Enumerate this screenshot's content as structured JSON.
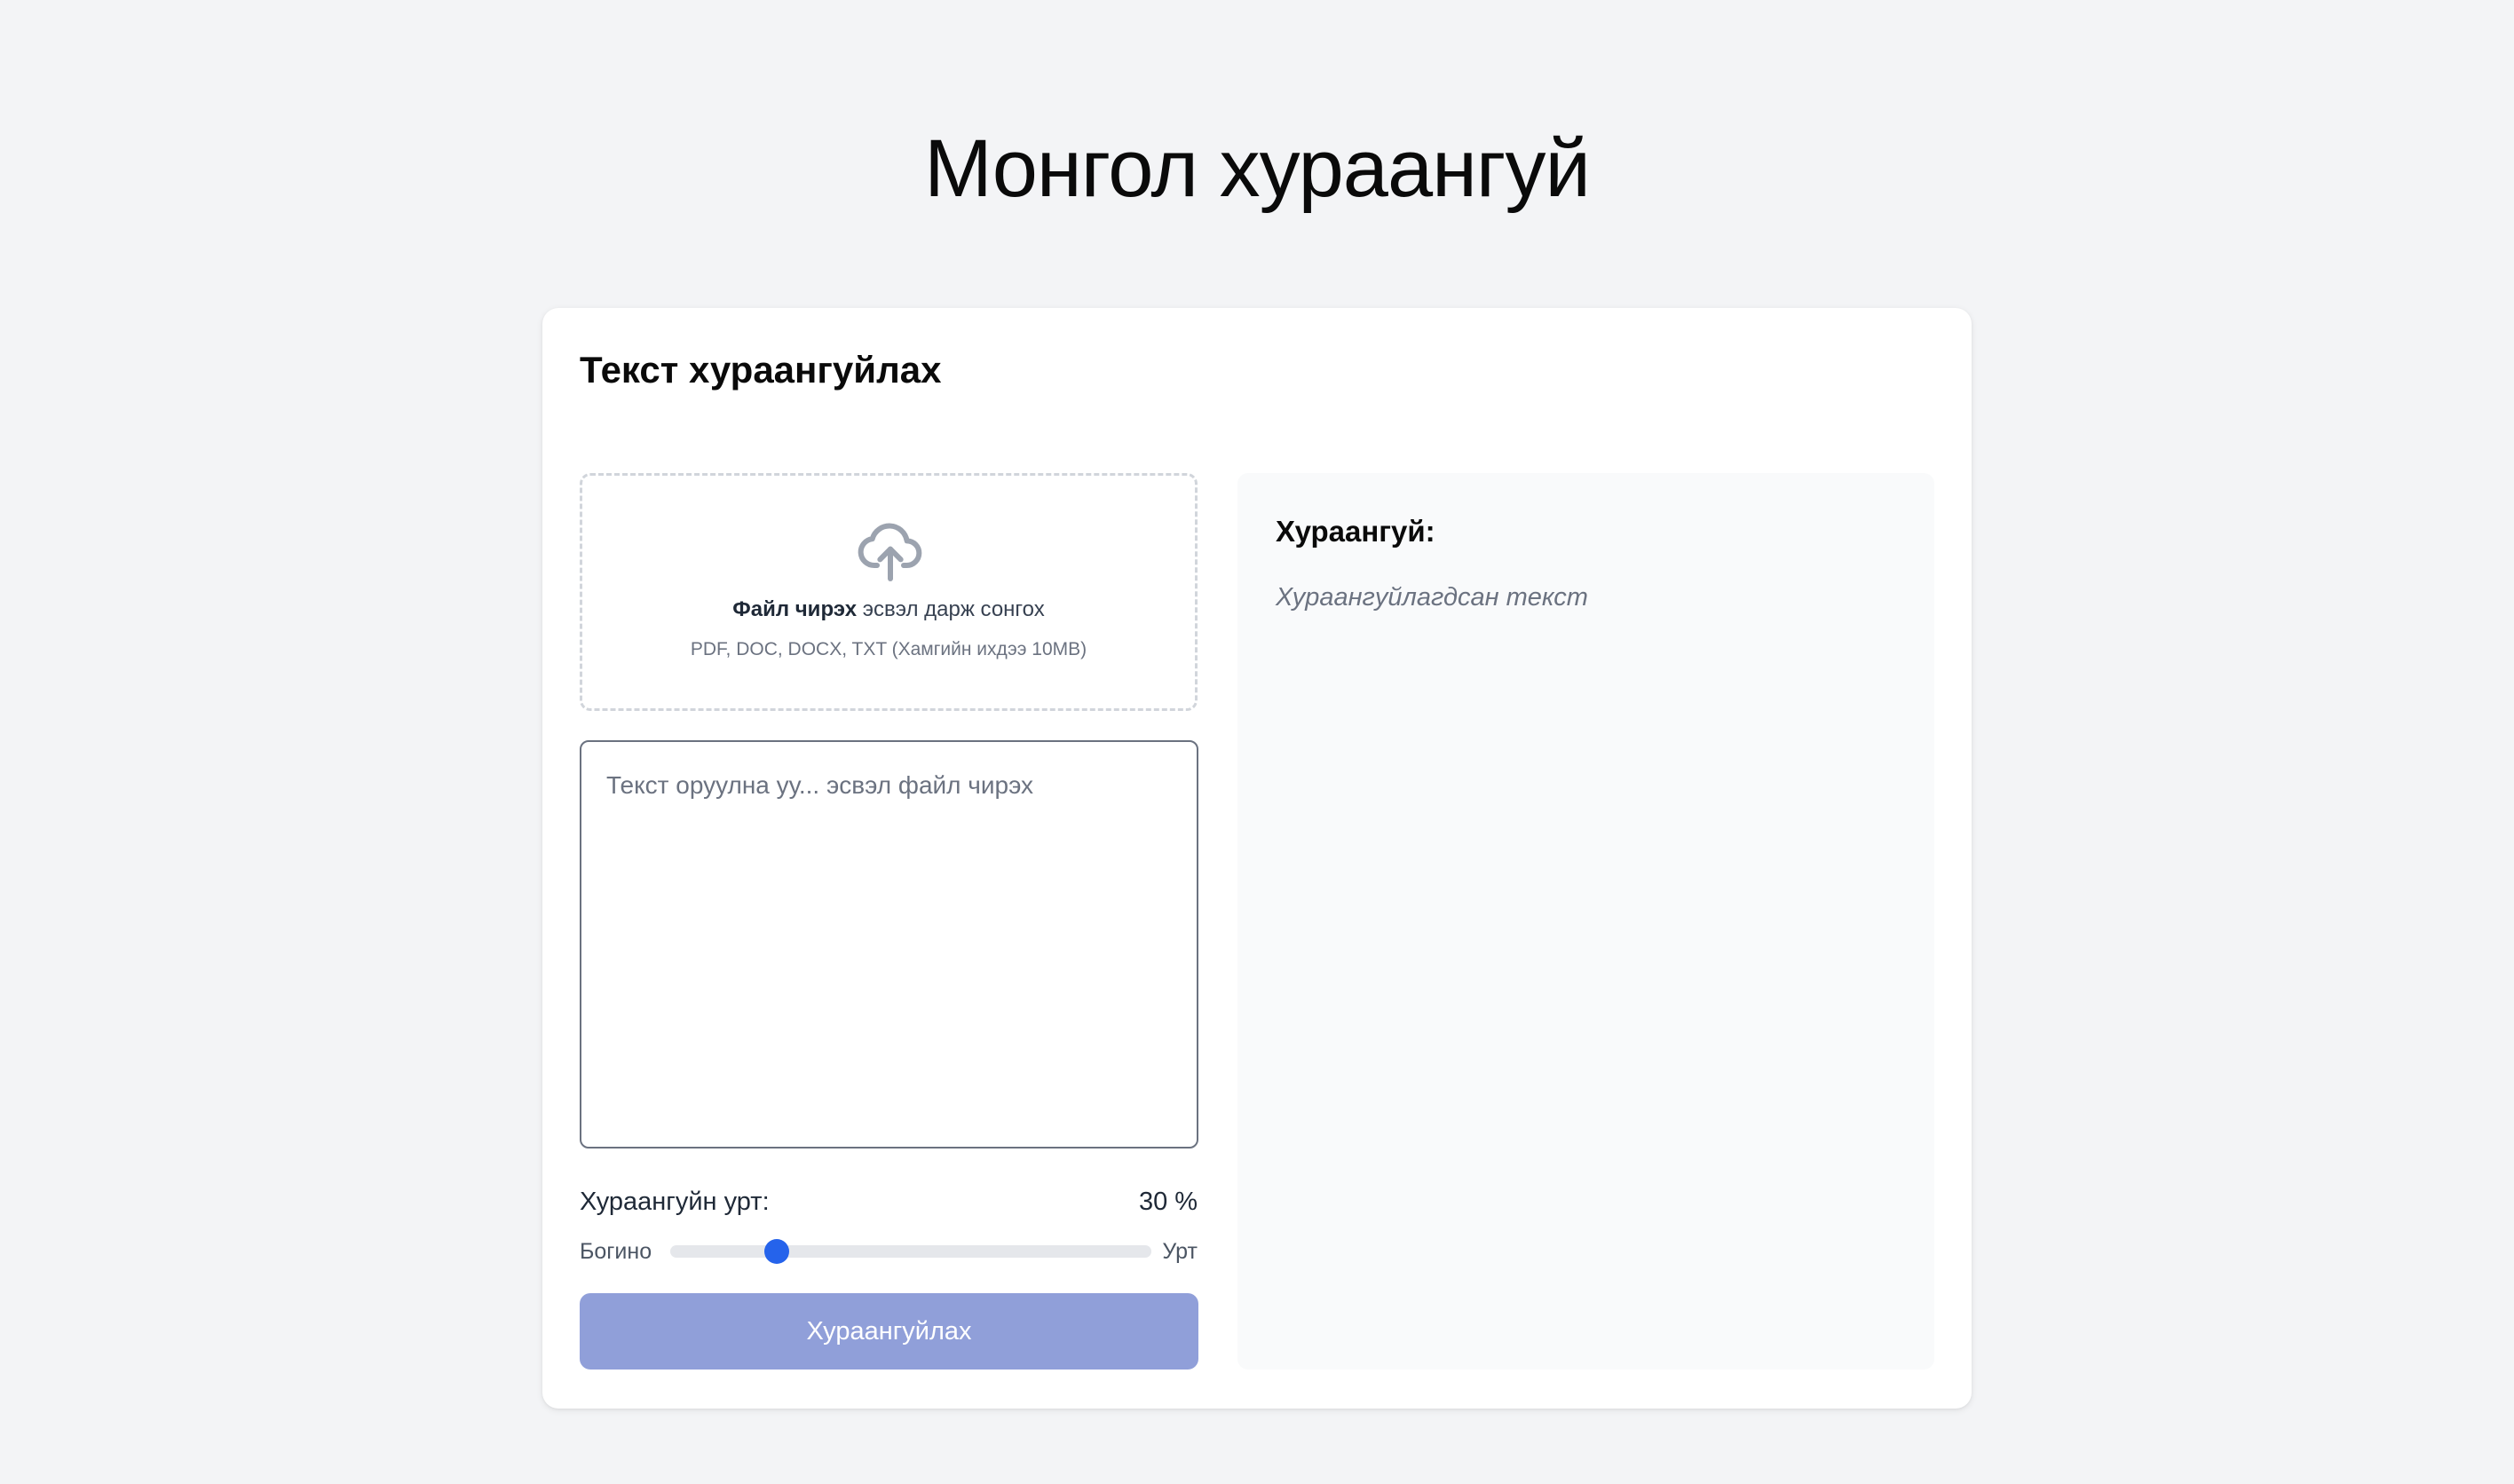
{
  "header": {
    "title": "Монгол хураангуй"
  },
  "card": {
    "title": "Текст хураангуйлах"
  },
  "upload": {
    "strong_text": "Файл чирэх",
    "rest_text": "эсвэл дарж сонгох",
    "formats": "PDF, DOC, DOCX, TXT (Хамгийн ихдээ 10MB)",
    "icon": "cloud-upload-icon"
  },
  "text_input": {
    "value": "",
    "placeholder": "Текст оруулна уу... эсвэл файл чирэх"
  },
  "length": {
    "label": "Хураангуйн урт:",
    "value": "30",
    "unit": "%",
    "percent": 30,
    "min_label": "Богино",
    "max_label": "Урт"
  },
  "submit": {
    "label": "Хураангуйлах",
    "color": "#909fd9"
  },
  "output": {
    "heading": "Хураангуй:",
    "placeholder": "Хураангуйлагдсан текст"
  },
  "colors": {
    "accent": "#2563eb",
    "background": "#f3f4f6",
    "panel": "#f9fafb"
  }
}
